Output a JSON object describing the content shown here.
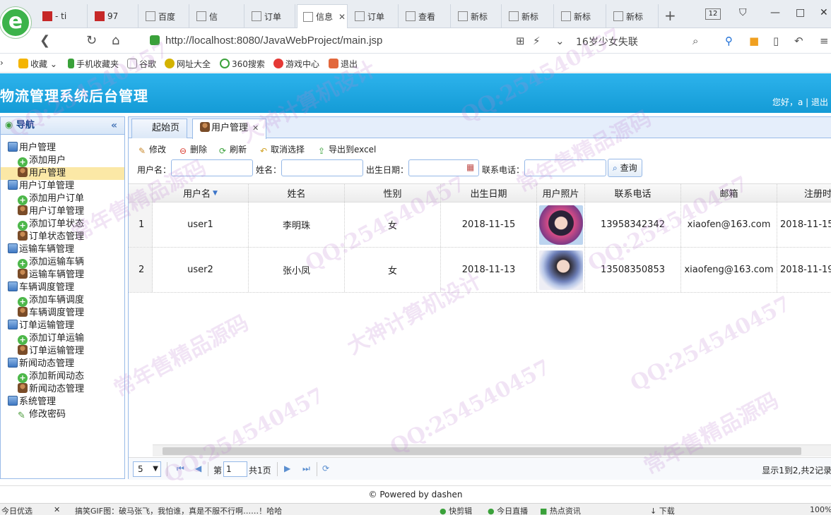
{
  "browser": {
    "tabs": [
      {
        "label": "- ti",
        "icon": "red-square-icon"
      },
      {
        "label": "97",
        "icon": "red-square-icon"
      },
      {
        "label": "百度",
        "icon": "paw-icon"
      },
      {
        "label": "信",
        "icon": "chart-icon"
      },
      {
        "label": "订单",
        "icon": "page-icon"
      },
      {
        "label": "信息",
        "icon": "chart-icon",
        "active": true
      },
      {
        "label": "订单",
        "icon": "page-icon"
      },
      {
        "label": "查看",
        "icon": "page-icon"
      },
      {
        "label": "新标",
        "icon": "grid-icon"
      },
      {
        "label": "新标",
        "icon": "grid-icon"
      },
      {
        "label": "新标",
        "icon": "grid-icon"
      },
      {
        "label": "新标",
        "icon": "grid-icon"
      }
    ],
    "tab_count": "12",
    "url_host": "http://localhost",
    "url_rest": ":8080/JavaWebProject/main.jsp",
    "search_hint": "16岁少女失联",
    "bookmarks": [
      "收藏",
      "手机收藏夹",
      "谷歌",
      "网址大全",
      "360搜索",
      "游戏中心",
      "退出"
    ]
  },
  "app": {
    "title": "物流管理系统后台管理",
    "greeting": "您好，a | 退出"
  },
  "sidebar": {
    "title": "导航",
    "nodes": [
      {
        "label": "用户管理",
        "type": "group"
      },
      {
        "label": "添加用户",
        "type": "add"
      },
      {
        "label": "用户管理",
        "type": "user",
        "selected": true
      },
      {
        "label": "用户订单管理",
        "type": "group"
      },
      {
        "label": "添加用户订单",
        "type": "add"
      },
      {
        "label": "用户订单管理",
        "type": "user"
      },
      {
        "label": "添加订单状态",
        "type": "add"
      },
      {
        "label": "订单状态管理",
        "type": "user"
      },
      {
        "label": "运输车辆管理",
        "type": "group"
      },
      {
        "label": "添加运输车辆",
        "type": "add"
      },
      {
        "label": "运输车辆管理",
        "type": "user"
      },
      {
        "label": "车辆调度管理",
        "type": "group"
      },
      {
        "label": "添加车辆调度",
        "type": "add"
      },
      {
        "label": "车辆调度管理",
        "type": "user"
      },
      {
        "label": "订单运输管理",
        "type": "group"
      },
      {
        "label": "添加订单运输",
        "type": "add"
      },
      {
        "label": "订单运输管理",
        "type": "user"
      },
      {
        "label": "新闻动态管理",
        "type": "group"
      },
      {
        "label": "添加新闻动态",
        "type": "add"
      },
      {
        "label": "新闻动态管理",
        "type": "user"
      },
      {
        "label": "系统管理",
        "type": "group"
      },
      {
        "label": "修改密码",
        "type": "edit"
      }
    ]
  },
  "main": {
    "tabs": [
      {
        "label": "起始页"
      },
      {
        "label": "用户管理",
        "active": true
      }
    ],
    "toolbar": {
      "edit": "修改",
      "delete": "删除",
      "refresh": "刷新",
      "cancel": "取消选择",
      "export": "导出到excel"
    },
    "search": {
      "username_label": "用户名：",
      "name_label": "姓名：",
      "birth_label": "出生日期：",
      "phone_label": "联系电话：",
      "username_value": "",
      "name_value": "",
      "birth_value": "",
      "phone_value": "",
      "button": "查询"
    },
    "columns": [
      "",
      "用户名",
      "姓名",
      "性别",
      "出生日期",
      "用户照片",
      "联系电话",
      "邮箱",
      "注册时"
    ],
    "rows": [
      {
        "num": "1",
        "username": "user1",
        "name": "李明珠",
        "gender": "女",
        "birth": "2018-11-15",
        "phone": "13958342342",
        "email": "xiaofen@163.com",
        "reg": "2018-11-15"
      },
      {
        "num": "2",
        "username": "user2",
        "name": "张小凤",
        "gender": "女",
        "birth": "2018-11-13",
        "phone": "13508350853",
        "email": "xiaofeng@163.com",
        "reg": "2018-11-19"
      }
    ],
    "pager": {
      "page_size": "5",
      "page_label": "第",
      "page_value": "1",
      "total_pages": "共1页",
      "summary": "显示1到2,共2记录"
    }
  },
  "footer": "© Powered by dashen",
  "statusbar": {
    "left": "今日优选",
    "news": "搞笑GIF图：破马张飞，我怕谁，真是不服不行啊……！哈哈",
    "items": [
      "快剪辑",
      "今日直播",
      "热点资讯",
      "下载",
      "100%"
    ]
  },
  "watermarks": [
    "QQ:254540457",
    "大神计算机设计",
    "常年售精品源码"
  ]
}
